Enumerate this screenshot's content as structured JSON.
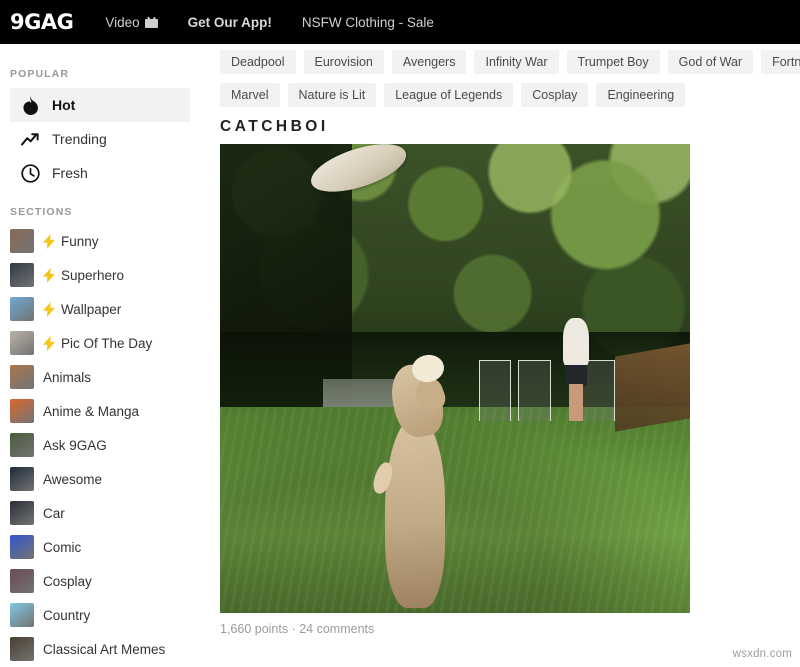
{
  "header": {
    "logo": "9GAG",
    "nav": [
      {
        "label": "Video",
        "icon": "tv-icon"
      },
      {
        "label": "Get Our App!",
        "icon": null
      },
      {
        "label": "NSFW Clothing - Sale",
        "icon": null
      }
    ]
  },
  "sidebar": {
    "popular_heading": "POPULAR",
    "popular": [
      {
        "label": "Hot",
        "icon": "flame-icon",
        "active": true
      },
      {
        "label": "Trending",
        "icon": "trending-arrow-icon",
        "active": false
      },
      {
        "label": "Fresh",
        "icon": "clock-icon",
        "active": false
      }
    ],
    "sections_heading": "SECTIONS",
    "sections": [
      {
        "label": "Funny",
        "bolt": true,
        "thumb": "#8a6a55"
      },
      {
        "label": "Superhero",
        "bolt": true,
        "thumb": "#2f3a44"
      },
      {
        "label": "Wallpaper",
        "bolt": true,
        "thumb": "#6fa8d4"
      },
      {
        "label": "Pic Of The Day",
        "bolt": true,
        "thumb": "#b9b2a8"
      },
      {
        "label": "Animals",
        "bolt": false,
        "thumb": "#a8784f"
      },
      {
        "label": "Anime & Manga",
        "bolt": false,
        "thumb": "#d9682e"
      },
      {
        "label": "Ask 9GAG",
        "bolt": false,
        "thumb": "#4a5b3a"
      },
      {
        "label": "Awesome",
        "bolt": false,
        "thumb": "#1e2a3a"
      },
      {
        "label": "Car",
        "bolt": false,
        "thumb": "#2b3138"
      },
      {
        "label": "Comic",
        "bolt": false,
        "thumb": "#3355cc"
      },
      {
        "label": "Cosplay",
        "bolt": false,
        "thumb": "#6b4a55"
      },
      {
        "label": "Country",
        "bolt": false,
        "thumb": "#7ec8e3"
      },
      {
        "label": "Classical Art Memes",
        "bolt": false,
        "thumb": "#4a3d2e"
      }
    ]
  },
  "tags": {
    "row1": [
      "Deadpool",
      "Eurovision",
      "Avengers",
      "Infinity War",
      "Trumpet Boy",
      "God of War",
      "Fortnite"
    ],
    "row2": [
      "Marvel",
      "Nature is Lit",
      "League of Legends",
      "Cosplay",
      "Engineering"
    ]
  },
  "post": {
    "title": "CATCHBOI",
    "meta": "1,660 points · 24 comments",
    "media_alt": "dog-catching-frisbee-gif"
  },
  "watermark": "wsxdn.com",
  "colors": {
    "header_bg": "#000000",
    "pill_bg": "#f2f2f2",
    "active_bg": "#f2f2f2",
    "bolt": "#f5c518",
    "meta_text": "#9a9a9a"
  }
}
